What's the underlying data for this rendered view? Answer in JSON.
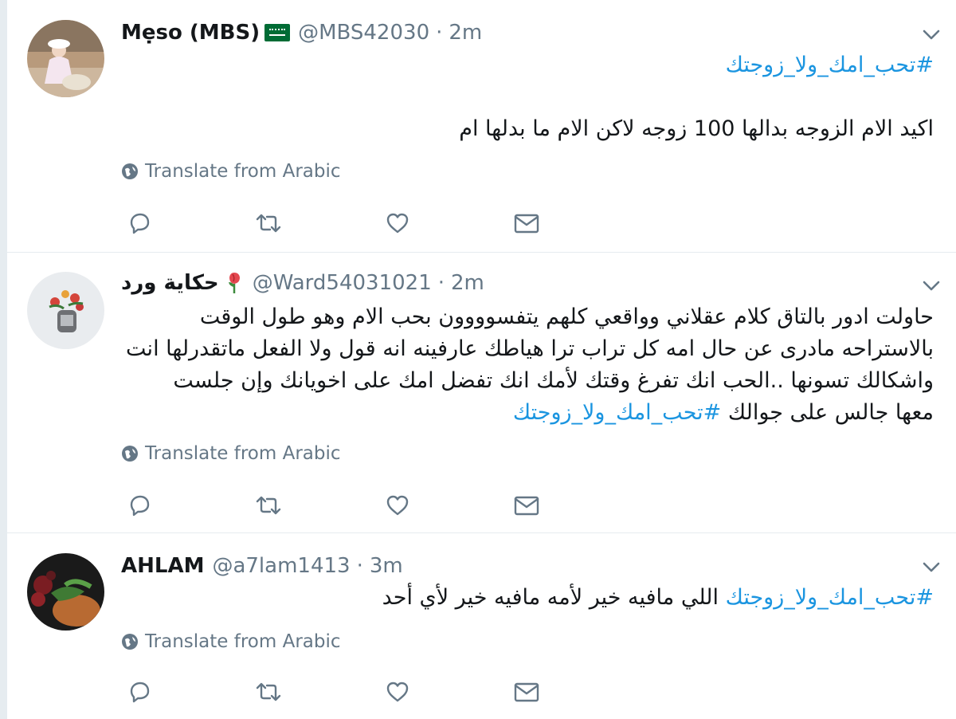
{
  "tweets": [
    {
      "name": "Mẹso (MBS)",
      "handle": "@MBS42030",
      "separator": "·",
      "time": "2m",
      "name_emoji": "saudi-flag",
      "hashtag_line": "#تحب_امك_ولا_زوجتك",
      "text": "اكيد الام  الزوجه بدالها 100 زوجه لاكن الام ما بدلها ام",
      "translate": "Translate from Arabic",
      "avatar_colors": [
        "#9c7a5a",
        "#d8c0a8",
        "#f5f0ea"
      ]
    },
    {
      "name": "حكاية ورد",
      "handle": "@Ward54031021",
      "separator": "·",
      "time": "2m",
      "name_emoji": "rose-emoji",
      "lines": [
        "حاولت ادور بالتاق كلام عقلاني وواقعي كلهم يتفسوووون  بحب الام وهو طول الوقت",
        "بالاستراحه مادرى عن حال امه كل تراب ترا هياطك عارفينه انه قول ولا الفعل ماتقدرلها انت",
        "واشكالك تسونها ..الحب انك تفرغ وقتك لأمك انك تفضل امك على اخويانك وإن جلست"
      ],
      "last_line_text": "معها جالس على جوالك  ",
      "last_line_hashtag": "#تحب_امك_ولا_زوجتك",
      "translate": "Translate from Arabic"
    },
    {
      "name": "AHLAM",
      "handle": "@a7lam1413",
      "separator": "·",
      "time": "3m",
      "hashtag": "#تحب_امك_ولا_زوجتك",
      "text": " اللي مافيه خير لأمه مافيه خير لأي أحد",
      "translate": "Translate from Arabic"
    }
  ],
  "colors": {
    "hashtag": "#1b95e0",
    "secondary_text": "#657786",
    "divider": "#e6ecf0"
  },
  "icons": [
    "reply-icon",
    "retweet-icon",
    "like-icon",
    "direct-message-icon",
    "globe-icon",
    "chevron-down-icon"
  ]
}
